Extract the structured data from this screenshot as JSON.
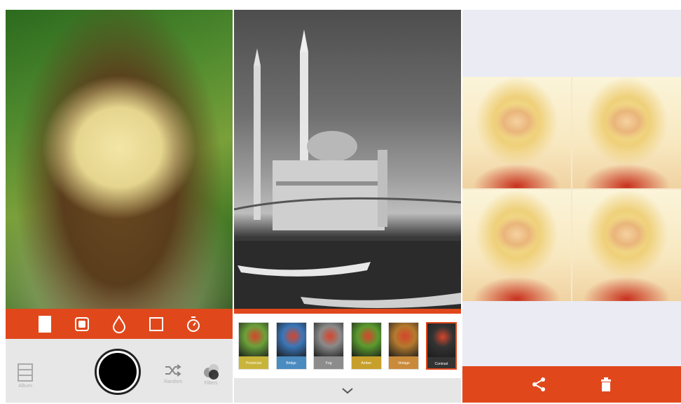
{
  "colors": {
    "accent": "#e0481c"
  },
  "camera_panel": {
    "toolbar_icons": [
      "portrait-frame-icon",
      "rounded-square-icon",
      "drop-icon",
      "square-icon",
      "timer-icon"
    ],
    "bottom": {
      "left_label": "Album",
      "shuffle_label": "Random",
      "effects_label": "Filters"
    }
  },
  "filter_panel": {
    "filters": [
      {
        "name": "Provincial",
        "caption_color": "#c9b43a"
      },
      {
        "name": "Bridge",
        "caption_color": "#4a8bc0"
      },
      {
        "name": "Fog",
        "caption_color": "#8c8c8c"
      },
      {
        "name": "Amber",
        "caption_color": "#c7a02c"
      },
      {
        "name": "Vintage",
        "caption_color": "#c98a3a"
      },
      {
        "name": "Contrast",
        "caption_color": "#333333"
      }
    ],
    "selected_filter": "Contrast",
    "expand_icon": "chevron-down-icon"
  },
  "collage_panel": {
    "tiles": 4,
    "actions": [
      "share-icon",
      "trash-icon"
    ]
  }
}
